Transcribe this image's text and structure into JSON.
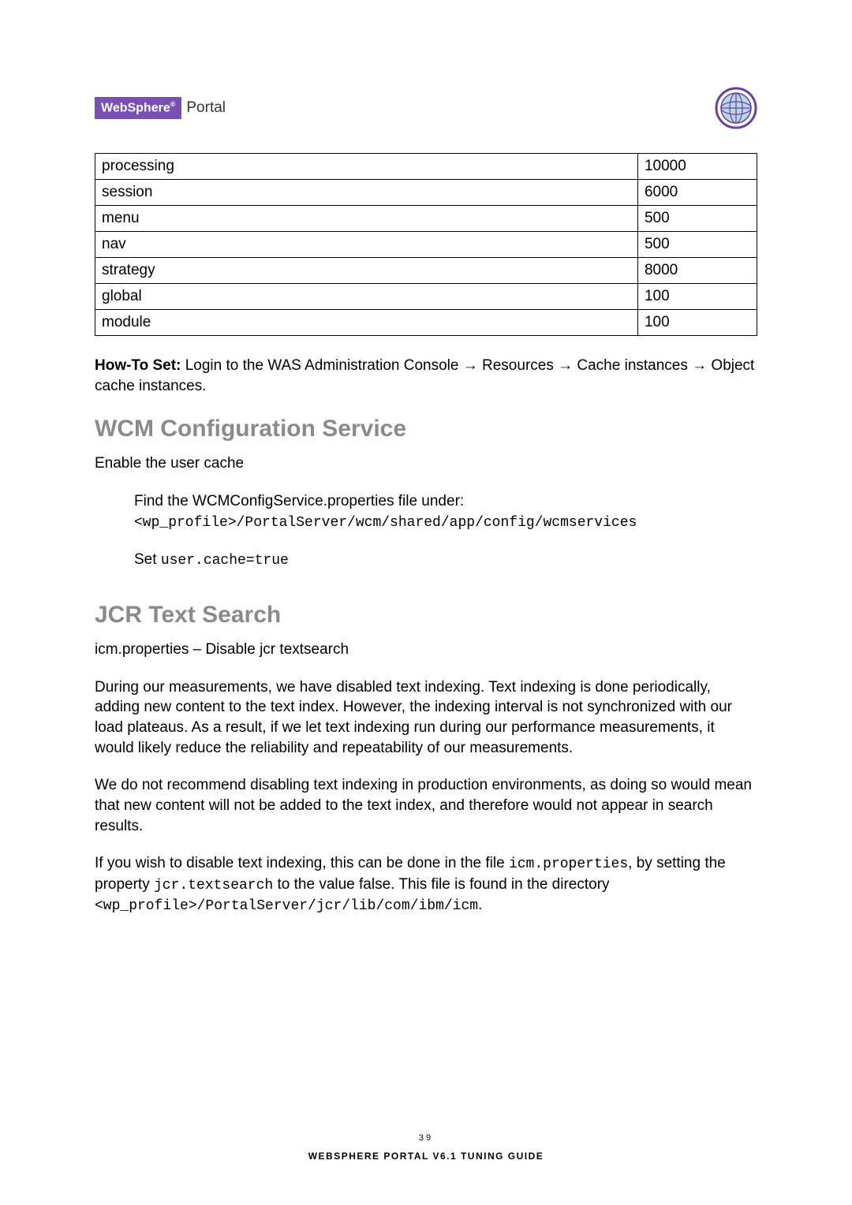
{
  "header": {
    "brand": "WebSphere",
    "brand_sub": "®",
    "product": "Portal"
  },
  "table": {
    "rows": [
      {
        "name": "processing",
        "value": "10000"
      },
      {
        "name": "session",
        "value": "6000"
      },
      {
        "name": "menu",
        "value": "500"
      },
      {
        "name": "nav",
        "value": "500"
      },
      {
        "name": "strategy",
        "value": "8000"
      },
      {
        "name": "global",
        "value": "100"
      },
      {
        "name": "module",
        "value": "100"
      }
    ]
  },
  "howto": {
    "label": "How-To Set:",
    "text": " Login to the WAS Administration Console → Resources → Cache instances → Object cache instances."
  },
  "section1": {
    "heading": "WCM Configuration Service",
    "p1": "Enable the user cache",
    "p2a": "Find the WCMConfigService.properties file under:",
    "p2b": "<wp_profile>/PortalServer/wcm/shared/app/config/wcmservices",
    "p3a": "Set ",
    "p3b": "user.cache=true"
  },
  "section2": {
    "heading": "JCR Text Search",
    "p1": "icm.properties – Disable jcr textsearch",
    "p2": "During our measurements, we have disabled text indexing. Text indexing is done periodically, adding new content to the text index. However, the indexing interval is not synchronized with our load plateaus. As a result, if we let text indexing run during our performance measurements, it would likely reduce the reliability and repeatability of our measurements.",
    "p3": "We do not recommend disabling text indexing in production environments, as doing so would mean that new content will not be added to the text index, and therefore would not appear in search results.",
    "p4_parts": {
      "t1": "If you wish to disable text indexing, this can be done in the file ",
      "m1": "icm.properties",
      "t2": ", by setting the property ",
      "m2": "jcr.textsearch",
      "t3": " to the value false. This file is found in the directory ",
      "m3": "<wp_profile>/PortalServer/jcr/lib/com/ibm/icm",
      "t4": "."
    }
  },
  "footer": {
    "page": "39",
    "title": "WEBSPHERE PORTAL V6.1 TUNING GUIDE"
  }
}
